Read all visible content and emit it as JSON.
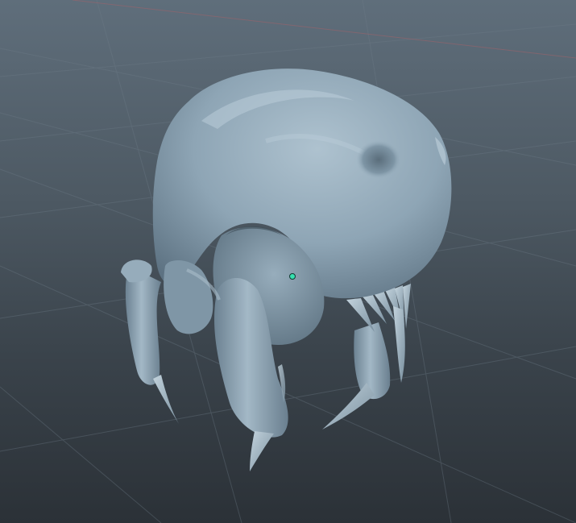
{
  "viewport": {
    "background_top": "#5f6e7b",
    "background_bottom": "#2b3137",
    "grid_color": "#6f7d89",
    "axis_line_color": "#a0626a"
  },
  "model": {
    "body_color": "#8fa6b6",
    "shadow_color": "#4f6270",
    "highlight_color": "#b9cbd6"
  },
  "pivot": {
    "color": "#36e0b0",
    "icon": "pivot-dot-icon"
  }
}
